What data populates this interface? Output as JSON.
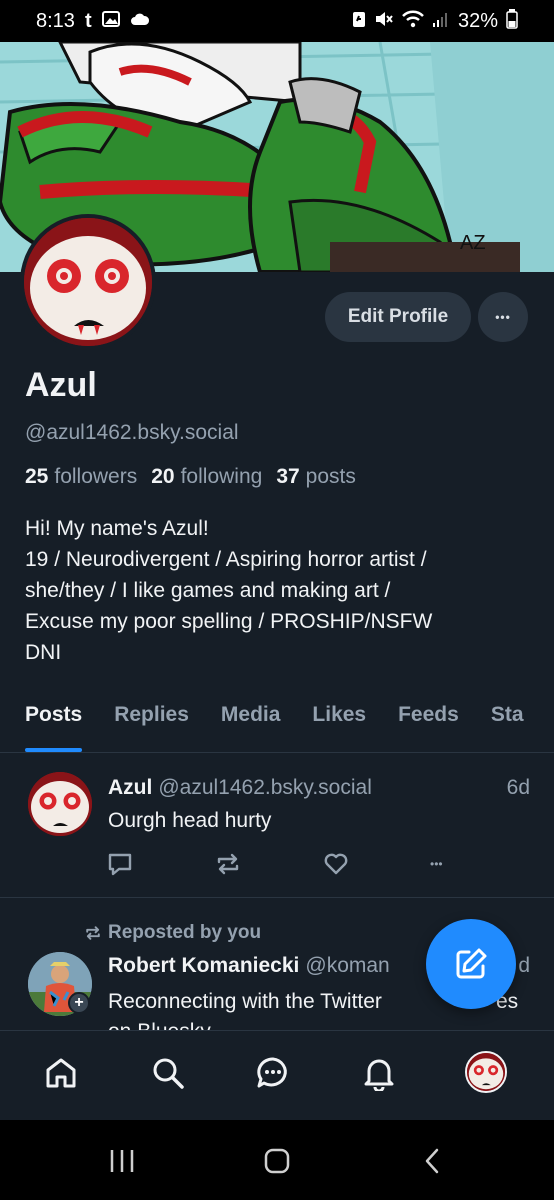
{
  "status_bar": {
    "time": "8:13",
    "notif_t": "t",
    "battery": "32%"
  },
  "banner": {
    "signature": "AZ"
  },
  "profile": {
    "edit_label": "Edit Profile",
    "more_label": "•••",
    "display_name": "Azul",
    "handle": "@azul1462.bsky.social",
    "followers_count": "25",
    "followers_label": "followers",
    "following_count": "20",
    "following_label": "following",
    "posts_count": "37",
    "posts_label": "posts",
    "bio_lines": [
      "Hi! My name's Azul!",
      "19 / Neurodivergent / Aspiring horror artist /",
      "she/they / I like games and making art /",
      "Excuse my poor spelling / PROSHIP/NSFW",
      "DNI"
    ]
  },
  "tabs": [
    "Posts",
    "Replies",
    "Media",
    "Likes",
    "Feeds",
    "Sta"
  ],
  "post": {
    "name": "Azul",
    "handle": "@azul1462.bsky.social",
    "time": "6d",
    "text": "Ourgh head hurty",
    "more_label": "•••"
  },
  "repost": {
    "label": "Reposted by you",
    "name": "Robert Komaniecki",
    "handle": "@koman",
    "time": "d",
    "text_line1": "Reconnecting with the Twitter",
    "text_line1_end": "es",
    "text_line2": "on Bluesky",
    "plus": "+"
  },
  "icons": {
    "reply": "reply-icon",
    "repost": "repost-icon",
    "like": "heart-icon",
    "compose": "compose-icon",
    "home": "home-icon",
    "search": "search-icon",
    "chat": "chat-icon",
    "notifications": "bell-icon"
  },
  "colors": {
    "accent": "#208bfe",
    "background": "#161e27",
    "muted": "#94a1af"
  }
}
